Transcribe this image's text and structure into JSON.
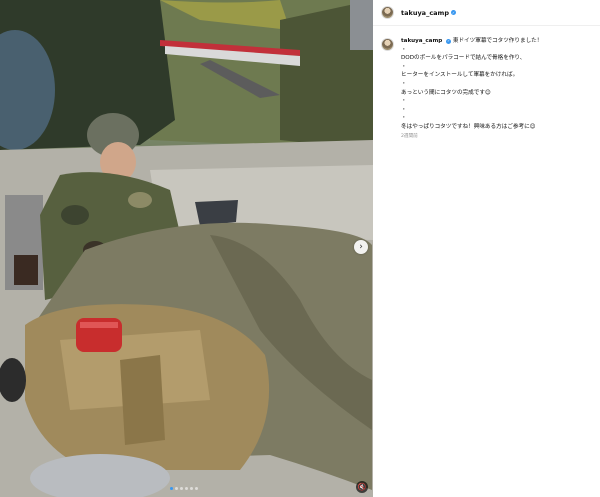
{
  "post": {
    "username": "takuya_camp",
    "verified_icon": "verified-badge-icon",
    "caption_lines": [
      "東ドイツ軍幕でコタツ作りました！",
      "・",
      "DODのポールをパラコードで結んで骨格を作り、",
      "・",
      "ヒーターをインストールして軍幕をかければ。",
      "・",
      "あっという間にコタツの完成です😊",
      "・",
      "・",
      "・",
      "冬はやっぱりコタツですね！興味ある方はご参考に😊"
    ],
    "timestamp": "2週間前"
  },
  "media": {
    "carousel_next_icon": "chevron-right-icon",
    "slide_count": 6,
    "active_slide": 0,
    "audio_icon": "speaker-muted-icon",
    "accent_color": "#3897f0"
  }
}
